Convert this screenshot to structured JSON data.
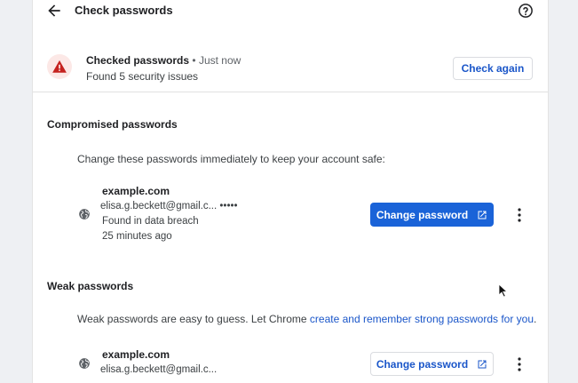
{
  "header": {
    "title": "Check passwords"
  },
  "status": {
    "checked_label": "Checked passwords",
    "separator": "•",
    "time": "Just now",
    "summary": "Found 5 security issues",
    "check_again_label": "Check again"
  },
  "compromised": {
    "title": "Compromised passwords",
    "description": "Change these passwords immediately to keep your account safe:",
    "items": [
      {
        "site": "example.com",
        "username": "elisa.g.beckett@gmail.c...",
        "password_mask": "•••••",
        "reason": "Found in data breach",
        "time": "25 minutes ago",
        "action_label": "Change password"
      }
    ]
  },
  "weak": {
    "title": "Weak passwords",
    "description_prefix": "Weak passwords are easy to guess. Let Chrome ",
    "description_link": "create and remember strong passwords for you",
    "description_suffix": ".",
    "items": [
      {
        "site": "example.com",
        "username": "elisa.g.beckett@gmail.c...",
        "action_label": "Change password"
      }
    ]
  },
  "colors": {
    "accent": "#1a63d8",
    "link": "#1a56c9",
    "warning": "#c5221f",
    "warning_bg": "#fce8e6"
  },
  "icons": {
    "back": "arrow-back-icon",
    "help": "help-icon",
    "warning": "warning-icon",
    "site": "globe-icon",
    "external": "open-in-new-icon",
    "more": "more-vert-icon"
  }
}
